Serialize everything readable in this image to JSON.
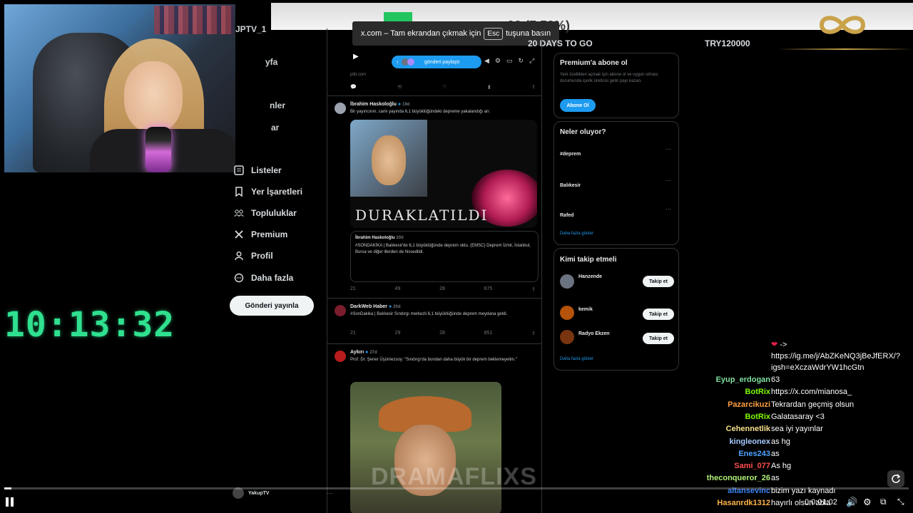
{
  "overlay": {
    "clock": "10:13:32",
    "tooltip": {
      "site": "x.com – Tam ekrandan çıkmak için",
      "key": "Esc",
      "suffix": "tuşuna basın"
    },
    "goal": {
      "amount_text": ".00 (7.52%)",
      "sub_text": "20 DAYS TO GO",
      "target": "TRY120000",
      "progress_fraction": 0.0752
    },
    "webcam_label": "JPTV_1"
  },
  "sidebar": {
    "partials": [
      "yfa",
      "nler",
      "ar"
    ],
    "items": [
      {
        "label": "Listeler",
        "icon": "list-icon"
      },
      {
        "label": "Yer İşaretleri",
        "icon": "bookmark-icon"
      },
      {
        "label": "Topluluklar",
        "icon": "communities-icon"
      },
      {
        "label": "Premium",
        "icon": "x-logo-icon"
      },
      {
        "label": "Profil",
        "icon": "profile-icon"
      },
      {
        "label": "Daha fazla",
        "icon": "more-circle-icon"
      }
    ],
    "post_button": "Gönderi yayınla",
    "profile_name": "YakupTV"
  },
  "feed": {
    "top_chip": "gönderi paylaştı",
    "top_source": "pliit.com",
    "posts": [
      {
        "author": "İbrahim Haskoloğlu",
        "time": "19d",
        "text": "Bir yayıncının, canlı yayında 6,1 büyüklüğündeki depreme yakalandığı an:",
        "paused_label": "DURAKLATILDI",
        "quote_author": "İbrahim Haskoloğlu",
        "quote_time": "20d",
        "quote_text": "#SONDAKİKA | Balıkesir'de 6,1 büyüklüğünde deprem oldu. (EMSC) Deprem İzmir, İstanbul, Bursa ve diğer illerden de hissedildi.",
        "stats": [
          "21",
          "49",
          "28",
          "675"
        ]
      },
      {
        "author": "DarkWeb Haber",
        "time": "20d",
        "text": "#SonDakika | Balıkesir Sındırgı merkezli 6,1 büyüklüğünde deprem meydana geldi.",
        "stats": [
          "21",
          "29",
          "28",
          "851"
        ]
      },
      {
        "author": "Aykırı",
        "time": "27d",
        "text": "Prof. Dr. Şener Üşümezsoy: \"Sındırgı'da bundan daha büyük bir deprem beklemeyelim.\"",
        "watermark": "DRAMAFLIXS"
      }
    ]
  },
  "right_column": {
    "premium": {
      "title": "Premium'a abone ol",
      "body": "Yeni özellikleri açmak için abone ol ve uygun olması durumunda içerik üreticisi geliri payı kazan.",
      "button": "Abone Ol"
    },
    "trends": {
      "title": "Neler oluyor?",
      "items": [
        "#deprem",
        "Balıkesir",
        "Rafed"
      ],
      "more": "Daha fazla göster"
    },
    "who_to_follow": {
      "title": "Kimi takip etmeli",
      "items": [
        {
          "name": "Hanzende"
        },
        {
          "name": "kemik"
        },
        {
          "name": "Radyo Ekzen"
        }
      ],
      "follow_label": "Takip et",
      "more": "Daha fazla göster"
    }
  },
  "player": {
    "time": "0:0:01:02",
    "progress_fraction": 0.008
  },
  "chat": {
    "partial_top": "https://ig.me/j/AbZKeNQ3jBeJfERX/?",
    "partial_top2": "igsh=eXczaWdrYW1hcGtn",
    "messages": [
      {
        "user": "Eyup_erdogan",
        "color": "#7ee0a0",
        "text": "63"
      },
      {
        "user": "BotRix",
        "color": "#7cfc00",
        "text": "https://x.com/mianosa_"
      },
      {
        "user": "Pazarcikuzi",
        "color": "#ff9f43",
        "text": "Tekrardan geçmiş olsun"
      },
      {
        "user": "BotRix",
        "color": "#7cfc00",
        "text": "Galatasaray <3"
      },
      {
        "user": "Cehennetlik",
        "color": "#f7e08b",
        "text": "sea iyi yayınlar"
      },
      {
        "user": "kingleonex",
        "color": "#a6c8ff",
        "text": "as hg"
      },
      {
        "user": "Enes243",
        "color": "#4da3ff",
        "text": "as"
      },
      {
        "user": "Sami_077",
        "color": "#ff4d4d",
        "text": "As hg"
      },
      {
        "user": "theconqueror_26",
        "color": "#b0f07a",
        "text": "as"
      },
      {
        "user": "altansevinc",
        "color": "#3b82f6",
        "text": "bizim yazı kaynadı"
      },
      {
        "user": "Hasanrdk1312",
        "color": "#ffb347",
        "text": "hayırlı olsun abla"
      }
    ]
  }
}
